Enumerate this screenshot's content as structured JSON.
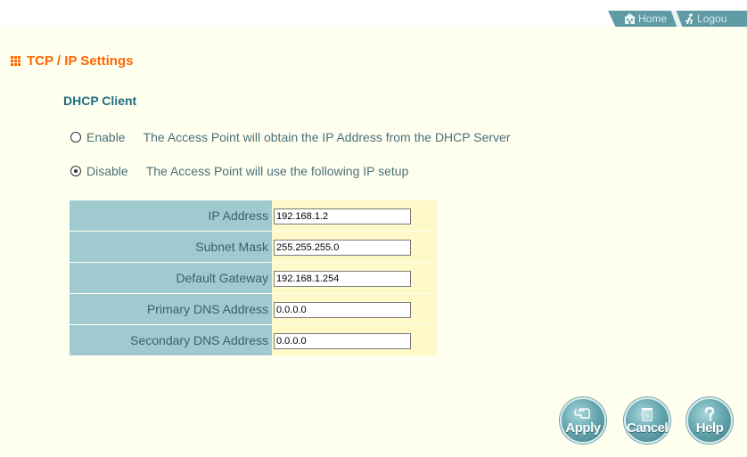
{
  "topbar": {
    "home_label": "Home",
    "logout_label": "Logou"
  },
  "page_title": "TCP / IP Settings",
  "dhcp": {
    "heading": "DHCP Client",
    "enable_label": "Enable",
    "enable_desc": "The Access Point  will obtain the IP Address from the DHCP Server",
    "disable_label": "Disable",
    "disable_desc": "The Access Point will use the following IP setup",
    "selected": "Disable"
  },
  "ip_fields": [
    {
      "label": "IP Address",
      "value": "192.168.1.2"
    },
    {
      "label": "Subnet Mask",
      "value": "255.255.255.0"
    },
    {
      "label": "Default Gateway",
      "value": "192.168.1.254"
    },
    {
      "label": "Primary DNS Address",
      "value": "0.0.0.0"
    },
    {
      "label": "Secondary DNS Address",
      "value": "0.0.0.0"
    }
  ],
  "buttons": {
    "apply": "Apply",
    "cancel": "Cancel",
    "help": "Help"
  },
  "colors": {
    "title": "#ff6600",
    "subhead": "#1f6e80",
    "label_cell": "#9fcbd0",
    "value_cell": "#fff8c8",
    "background": "#fffff0",
    "topbar": "#5f9aa5"
  },
  "icons": [
    "home-icon",
    "logout-icon",
    "title-grid-icon",
    "apply-icon",
    "cancel-icon",
    "help-icon"
  ]
}
